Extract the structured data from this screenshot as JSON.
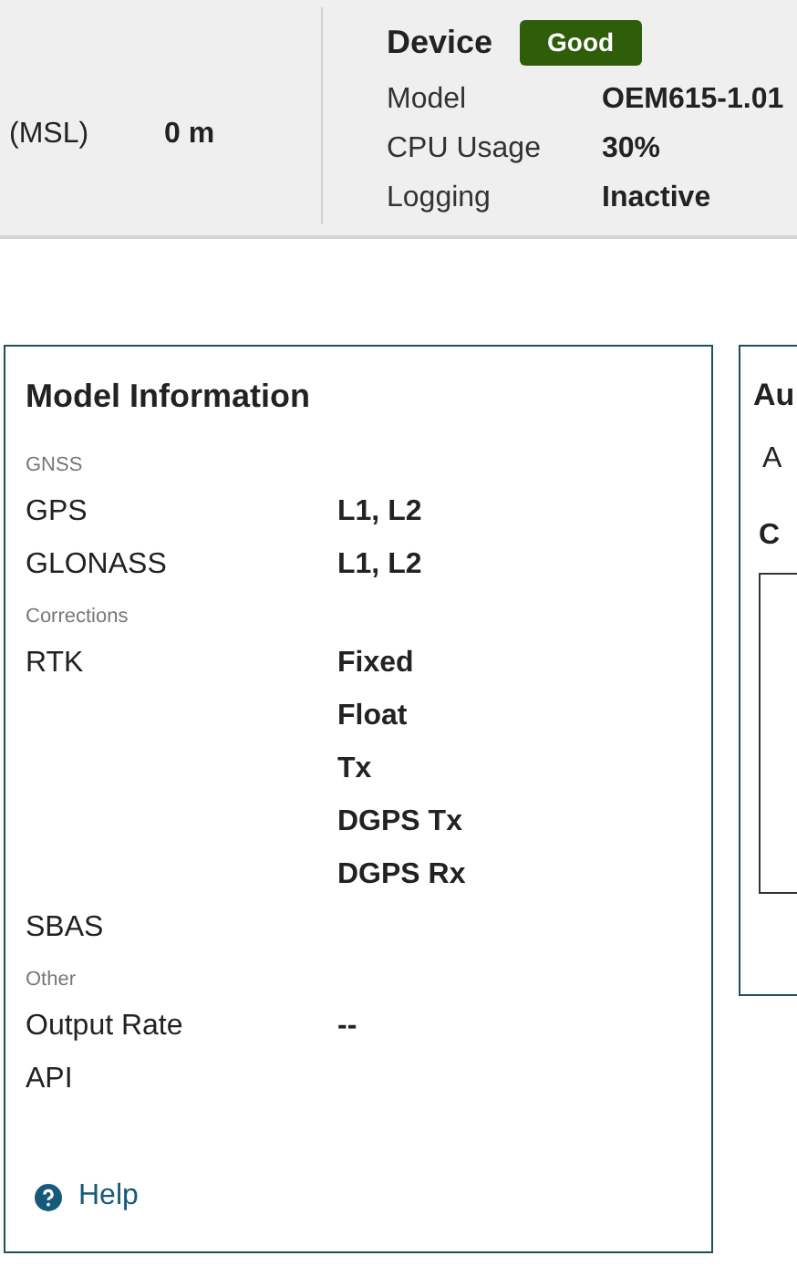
{
  "header": {
    "altitude": {
      "label": "(MSL)",
      "value": "0 m"
    },
    "device": {
      "title": "Device",
      "status": "Good",
      "rows": [
        {
          "label": "Model",
          "value": "OEM615-1.01"
        },
        {
          "label": "CPU Usage",
          "value": "30%"
        },
        {
          "label": "Logging",
          "value": "Inactive"
        }
      ]
    }
  },
  "model_info": {
    "title": "Model Information",
    "sections": [
      {
        "heading": "GNSS",
        "rows": [
          {
            "label": "GPS",
            "values": [
              "L1, L2"
            ]
          },
          {
            "label": "GLONASS",
            "values": [
              "L1, L2"
            ]
          }
        ]
      },
      {
        "heading": "Corrections",
        "rows": [
          {
            "label": "RTK",
            "values": [
              "Fixed",
              "Float",
              "Tx",
              "DGPS Tx",
              "DGPS Rx"
            ]
          },
          {
            "label": "SBAS",
            "values": []
          }
        ]
      },
      {
        "heading": "Other",
        "rows": [
          {
            "label": "Output Rate",
            "values": [
              "--"
            ]
          },
          {
            "label": "API",
            "values": []
          }
        ]
      }
    ],
    "help": "Help"
  },
  "side_panel": {
    "title": "Au",
    "text": "A",
    "subheading": "C"
  }
}
